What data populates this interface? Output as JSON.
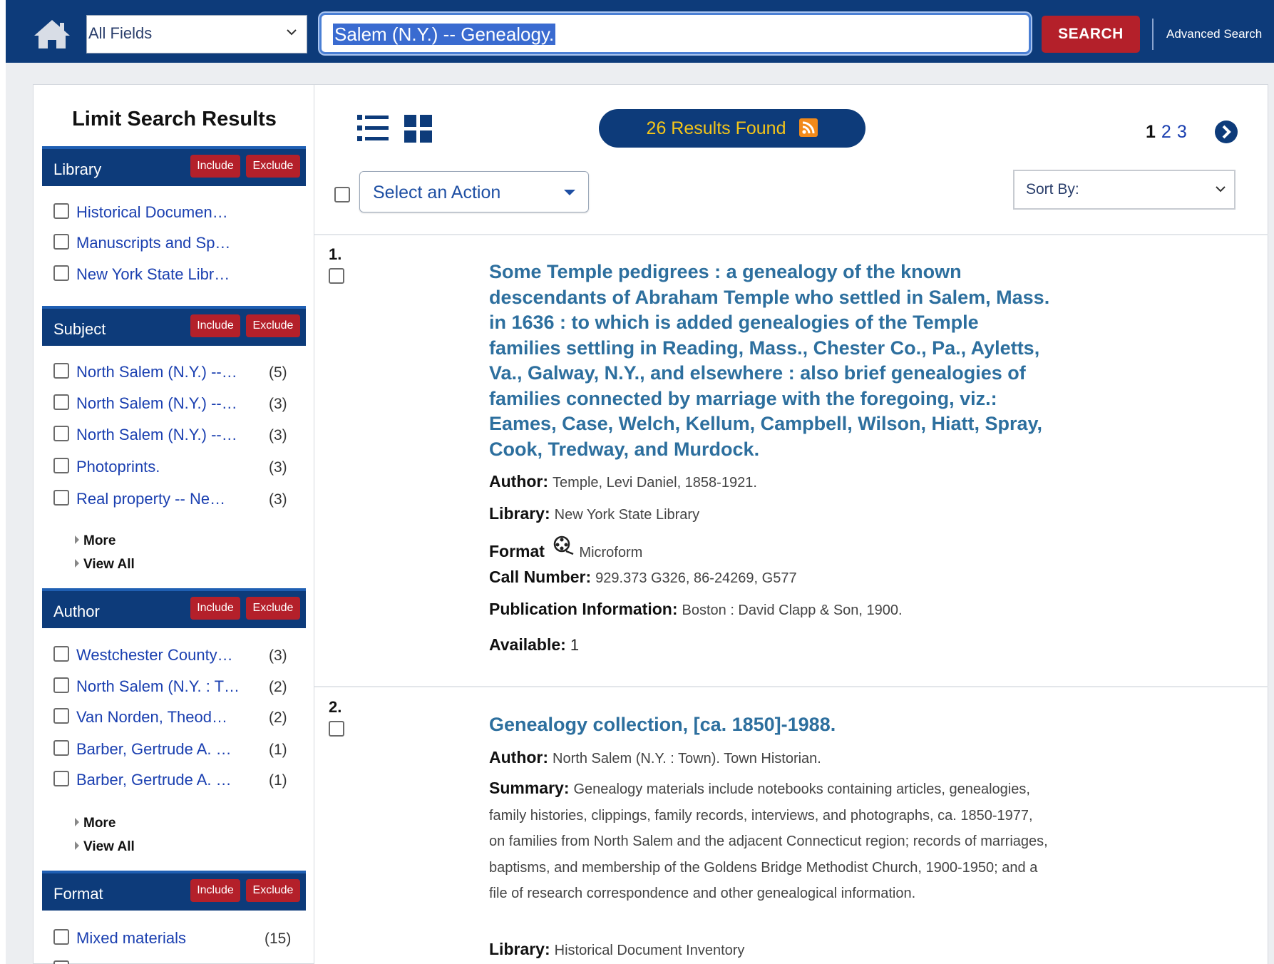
{
  "header": {
    "field_select": "All Fields",
    "search_query": "Salem (N.Y.) -- Genealogy.",
    "search_button": "SEARCH",
    "advanced_search": "Advanced Search"
  },
  "sidebar": {
    "title": "Limit Search Results",
    "include_label": "Include",
    "exclude_label": "Exclude",
    "more_label": "More",
    "view_all_label": "View All",
    "facets": [
      {
        "name": "Library",
        "items": [
          {
            "label": "Historical Documen…",
            "count": ""
          },
          {
            "label": "Manuscripts and Sp…",
            "count": ""
          },
          {
            "label": "New York State Libr…",
            "count": ""
          }
        ]
      },
      {
        "name": "Subject",
        "items": [
          {
            "label": "North Salem (N.Y.) --…",
            "count": "(5)"
          },
          {
            "label": "North Salem (N.Y.) --…",
            "count": "(3)"
          },
          {
            "label": "North Salem (N.Y.) --…",
            "count": "(3)"
          },
          {
            "label": "Photoprints.",
            "count": "(3)"
          },
          {
            "label": "Real property -- Ne…",
            "count": "(3)"
          }
        ]
      },
      {
        "name": "Author",
        "items": [
          {
            "label": "Westchester County…",
            "count": "(3)"
          },
          {
            "label": "North Salem (N.Y. : T…",
            "count": "(2)"
          },
          {
            "label": "Van Norden, Theod…",
            "count": "(2)"
          },
          {
            "label": "Barber, Gertrude A. …",
            "count": "(1)"
          },
          {
            "label": "Barber, Gertrude A. …",
            "count": "(1)"
          }
        ]
      },
      {
        "name": "Format",
        "items": [
          {
            "label": "Mixed materials",
            "count": "(15)"
          }
        ]
      }
    ]
  },
  "main": {
    "results_found": "26 Results Found",
    "pages": [
      "1",
      "2",
      "3"
    ],
    "current_page": "1",
    "action_select": "Select an Action",
    "sort_by": "Sort By:",
    "results": [
      {
        "number": "1.",
        "title": "Some Temple pedigrees : a genealogy of the known descendants of Abraham Temple who settled in Salem, Mass. in 1636 : to which is added genealogies of the Temple families settling in Reading, Mass., Chester Co., Pa., Ayletts, Va., Galway, N.Y., and elsewhere : also brief genealogies of families connected by marriage with the foregoing, viz.: Eames, Case, Welch, Kellum, Campbell, Wilson, Hiatt, Spray, Cook, Tredway, and Murdock.",
        "author_label": "Author:",
        "author": "Temple, Levi Daniel, 1858-1921.",
        "library_label": "Library:",
        "library": "New York State Library",
        "format_label": "Format",
        "format": "Microform",
        "call_number_label": "Call Number:",
        "call_number": "929.373 G326, 86-24269, G577",
        "publication_label": "Publication Information:",
        "publication": "Boston : David Clapp & Son, 1900.",
        "available_label": "Available:",
        "available": "1"
      },
      {
        "number": "2.",
        "title": "Genealogy collection, [ca. 1850]-1988.",
        "author_label": "Author:",
        "author": "North Salem (N.Y. : Town). Town Historian.",
        "summary_label": "Summary:",
        "summary": "Genealogy materials include notebooks containing articles, genealogies, family histories, clippings, family records, interviews, and photographs, ca. 1850-1977, on families from North Salem and the adjacent Connecticut region; records of marriages, baptisms, and membership of the Goldens Bridge Methodist Church, 1900-1950; and a file of research correspondence and other genealogical information.",
        "library_label": "Library:",
        "library": "Historical Document Inventory"
      }
    ]
  }
}
